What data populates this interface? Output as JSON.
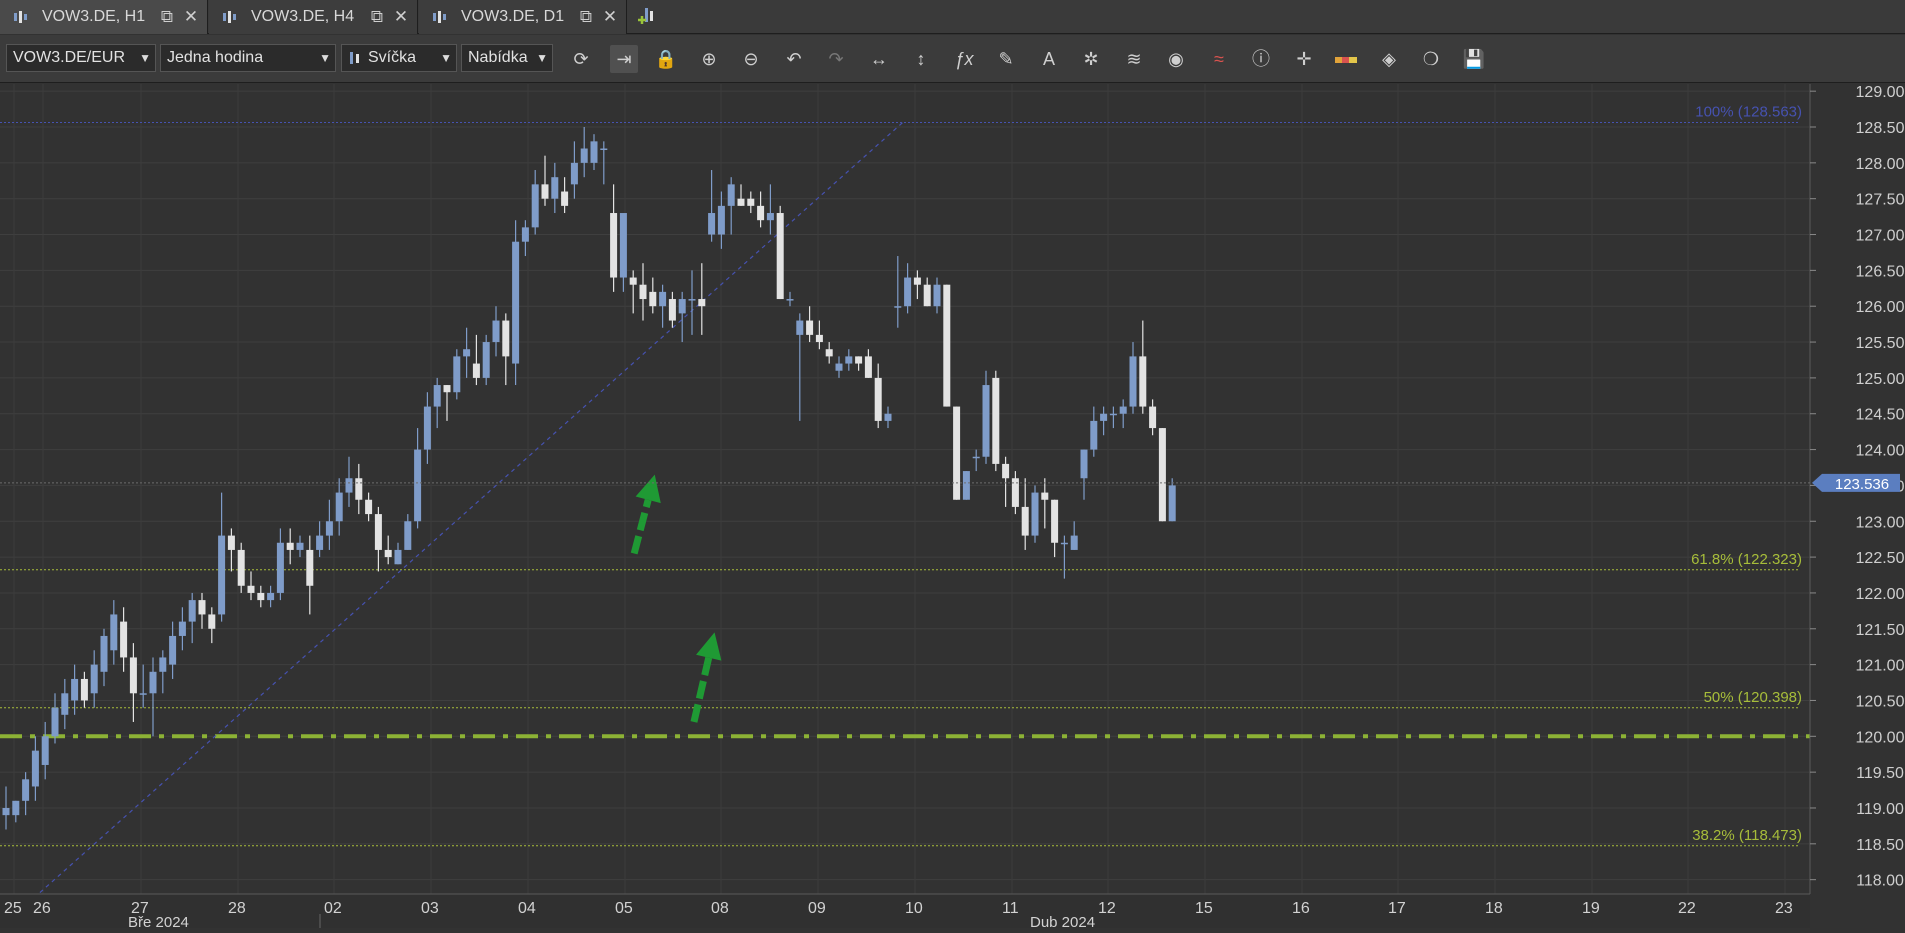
{
  "tabs": [
    {
      "label": "VOW3.DE, H1",
      "active": true
    },
    {
      "label": "VOW3.DE, H4",
      "active": false
    },
    {
      "label": "VOW3.DE, D1",
      "active": false
    }
  ],
  "toolbar": {
    "instrument": "VOW3.DE/EUR",
    "period": "Jedna hodina",
    "chart_type": "Svíčka",
    "price_type": "Nabídka"
  },
  "colors": {
    "background": "#323232",
    "bull": "#7f9cc9",
    "bear": "#e3e3e3",
    "fib_line": "#a7bd3a",
    "level_line": "#8cb235",
    "high_line": "#4652b0",
    "arrow": "#1f9a34",
    "price_badge": "#5b7ec0"
  },
  "chart_data": {
    "type": "candlestick",
    "y_range": [
      117.8,
      129.1
    ],
    "y_ticks": [
      "118.00",
      "118.50",
      "119.00",
      "119.50",
      "120.00",
      "120.50",
      "121.00",
      "121.50",
      "122.00",
      "122.50",
      "123.00",
      "123.50",
      "124.00",
      "124.50",
      "125.00",
      "125.50",
      "126.00",
      "126.50",
      "127.00",
      "127.50",
      "128.00",
      "128.50",
      "129.00"
    ],
    "x_ticks": [
      "25",
      "26",
      "27",
      "28",
      "02",
      "03",
      "04",
      "05",
      "08",
      "09",
      "10",
      "11",
      "12",
      "15",
      "16",
      "17",
      "18",
      "19",
      "22",
      "23"
    ],
    "month_labels": [
      "Bře 2024",
      "Dub 2024"
    ],
    "current_price": "123.536",
    "levels": [
      {
        "label": "100% (128.563)",
        "value": 128.563,
        "color": "#4652b0"
      },
      {
        "label": "61.8% (122.323)",
        "value": 122.323,
        "color": "#a7bd3a"
      },
      {
        "label": "50% (120.398)",
        "value": 120.398,
        "color": "#a7bd3a"
      },
      {
        "label": "38.2% (118.473)",
        "value": 118.473,
        "color": "#a7bd3a"
      }
    ],
    "support_level": 120.0,
    "trend_line": {
      "start": [
        -0.8,
        117.3
      ],
      "end": [
        91.5,
        128.563
      ]
    },
    "arrows": [
      {
        "from": [
          64.1,
          122.55
        ],
        "to": [
          66.2,
          123.65
        ]
      },
      {
        "from": [
          70.2,
          120.2
        ],
        "to": [
          72.3,
          121.45
        ]
      }
    ],
    "candles": [
      {
        "i": 0,
        "o": 118.9,
        "h": 119.3,
        "l": 118.7,
        "c": 119.0
      },
      {
        "i": 1,
        "o": 118.9,
        "h": 119.1,
        "l": 118.8,
        "c": 119.1
      },
      {
        "i": 2,
        "o": 119.1,
        "h": 119.5,
        "l": 118.9,
        "c": 119.4
      },
      {
        "i": 3,
        "o": 119.3,
        "h": 120.0,
        "l": 119.1,
        "c": 119.8
      },
      {
        "i": 4,
        "o": 119.6,
        "h": 120.2,
        "l": 119.4,
        "c": 120.0
      },
      {
        "i": 5,
        "o": 120.0,
        "h": 120.6,
        "l": 119.9,
        "c": 120.4
      },
      {
        "i": 6,
        "o": 120.3,
        "h": 120.8,
        "l": 120.1,
        "c": 120.6
      },
      {
        "i": 7,
        "o": 120.5,
        "h": 121.0,
        "l": 120.3,
        "c": 120.8
      },
      {
        "i": 8,
        "o": 120.8,
        "h": 120.9,
        "l": 120.4,
        "c": 120.5
      },
      {
        "i": 9,
        "o": 120.6,
        "h": 121.2,
        "l": 120.4,
        "c": 121.0
      },
      {
        "i": 10,
        "o": 120.9,
        "h": 121.5,
        "l": 120.7,
        "c": 121.4
      },
      {
        "i": 11,
        "o": 121.2,
        "h": 121.9,
        "l": 121.0,
        "c": 121.7
      },
      {
        "i": 12,
        "o": 121.6,
        "h": 121.8,
        "l": 120.9,
        "c": 121.1
      },
      {
        "i": 13,
        "o": 121.1,
        "h": 121.3,
        "l": 120.2,
        "c": 120.6
      },
      {
        "i": 14,
        "o": 120.6,
        "h": 121.0,
        "l": 120.4,
        "c": 120.6
      },
      {
        "i": 15,
        "o": 120.6,
        "h": 121.1,
        "l": 120.0,
        "c": 120.9
      },
      {
        "i": 16,
        "o": 120.9,
        "h": 121.2,
        "l": 120.6,
        "c": 121.1
      },
      {
        "i": 17,
        "o": 121.0,
        "h": 121.6,
        "l": 120.8,
        "c": 121.4
      },
      {
        "i": 18,
        "o": 121.4,
        "h": 121.8,
        "l": 121.2,
        "c": 121.6
      },
      {
        "i": 19,
        "o": 121.6,
        "h": 122.0,
        "l": 121.3,
        "c": 121.9
      },
      {
        "i": 20,
        "o": 121.9,
        "h": 122.0,
        "l": 121.5,
        "c": 121.7
      },
      {
        "i": 21,
        "o": 121.7,
        "h": 121.8,
        "l": 121.3,
        "c": 121.5
      },
      {
        "i": 22,
        "o": 121.7,
        "h": 123.4,
        "l": 121.6,
        "c": 122.8
      },
      {
        "i": 23,
        "o": 122.8,
        "h": 122.9,
        "l": 122.3,
        "c": 122.6
      },
      {
        "i": 24,
        "o": 122.6,
        "h": 122.7,
        "l": 122.0,
        "c": 122.1
      },
      {
        "i": 25,
        "o": 122.1,
        "h": 122.3,
        "l": 121.9,
        "c": 122.0
      },
      {
        "i": 26,
        "o": 122.0,
        "h": 122.1,
        "l": 121.8,
        "c": 121.9
      },
      {
        "i": 27,
        "o": 121.9,
        "h": 122.1,
        "l": 121.8,
        "c": 122.0
      },
      {
        "i": 28,
        "o": 122.0,
        "h": 122.9,
        "l": 121.9,
        "c": 122.7
      },
      {
        "i": 29,
        "o": 122.7,
        "h": 122.9,
        "l": 122.4,
        "c": 122.6
      },
      {
        "i": 30,
        "o": 122.6,
        "h": 122.8,
        "l": 122.5,
        "c": 122.7
      },
      {
        "i": 31,
        "o": 122.6,
        "h": 122.8,
        "l": 121.7,
        "c": 122.1
      },
      {
        "i": 32,
        "o": 122.6,
        "h": 123.0,
        "l": 122.5,
        "c": 122.8
      },
      {
        "i": 33,
        "o": 122.8,
        "h": 123.3,
        "l": 122.6,
        "c": 123.0
      },
      {
        "i": 34,
        "o": 123.0,
        "h": 123.6,
        "l": 122.8,
        "c": 123.4
      },
      {
        "i": 35,
        "o": 123.4,
        "h": 123.9,
        "l": 123.2,
        "c": 123.6
      },
      {
        "i": 36,
        "o": 123.6,
        "h": 123.8,
        "l": 123.1,
        "c": 123.3
      },
      {
        "i": 37,
        "o": 123.3,
        "h": 123.4,
        "l": 123.0,
        "c": 123.1
      },
      {
        "i": 38,
        "o": 123.1,
        "h": 123.2,
        "l": 122.3,
        "c": 122.6
      },
      {
        "i": 39,
        "o": 122.6,
        "h": 122.8,
        "l": 122.4,
        "c": 122.5
      },
      {
        "i": 40,
        "o": 122.4,
        "h": 122.7,
        "l": 122.4,
        "c": 122.6
      },
      {
        "i": 41,
        "o": 122.6,
        "h": 123.1,
        "l": 122.6,
        "c": 123.0
      },
      {
        "i": 42,
        "o": 123.0,
        "h": 124.3,
        "l": 122.9,
        "c": 124.0
      },
      {
        "i": 43,
        "o": 124.0,
        "h": 124.8,
        "l": 123.8,
        "c": 124.6
      },
      {
        "i": 44,
        "o": 124.6,
        "h": 125.0,
        "l": 124.3,
        "c": 124.9
      },
      {
        "i": 45,
        "o": 124.9,
        "h": 124.9,
        "l": 124.4,
        "c": 124.8
      },
      {
        "i": 46,
        "o": 124.8,
        "h": 125.4,
        "l": 124.7,
        "c": 125.3
      },
      {
        "i": 47,
        "o": 125.3,
        "h": 125.7,
        "l": 125.0,
        "c": 125.4
      },
      {
        "i": 48,
        "o": 125.2,
        "h": 125.6,
        "l": 124.9,
        "c": 125.0
      },
      {
        "i": 49,
        "o": 125.0,
        "h": 125.6,
        "l": 124.9,
        "c": 125.5
      },
      {
        "i": 50,
        "o": 125.5,
        "h": 126.0,
        "l": 125.3,
        "c": 125.8
      },
      {
        "i": 51,
        "o": 125.8,
        "h": 125.9,
        "l": 124.9,
        "c": 125.3
      },
      {
        "i": 52,
        "o": 125.2,
        "h": 127.2,
        "l": 124.9,
        "c": 126.9
      },
      {
        "i": 53,
        "o": 126.9,
        "h": 127.2,
        "l": 126.7,
        "c": 127.1
      },
      {
        "i": 54,
        "o": 127.1,
        "h": 127.9,
        "l": 127.0,
        "c": 127.7
      },
      {
        "i": 55,
        "o": 127.7,
        "h": 128.1,
        "l": 127.4,
        "c": 127.5
      },
      {
        "i": 56,
        "o": 127.5,
        "h": 128.0,
        "l": 127.3,
        "c": 127.8
      },
      {
        "i": 57,
        "o": 127.6,
        "h": 127.8,
        "l": 127.3,
        "c": 127.4
      },
      {
        "i": 58,
        "o": 127.7,
        "h": 128.3,
        "l": 127.5,
        "c": 128.0
      },
      {
        "i": 59,
        "o": 128.0,
        "h": 128.5,
        "l": 127.8,
        "c": 128.2
      },
      {
        "i": 60,
        "o": 128.0,
        "h": 128.4,
        "l": 127.9,
        "c": 128.3
      },
      {
        "i": 61,
        "o": 128.2,
        "h": 128.3,
        "l": 127.7,
        "c": 128.2
      },
      {
        "i": 62,
        "o": 127.3,
        "h": 127.7,
        "l": 126.2,
        "c": 126.4
      },
      {
        "i": 63,
        "o": 126.4,
        "h": 126.9,
        "l": 126.2,
        "c": 127.3
      },
      {
        "i": 64,
        "o": 126.4,
        "h": 126.5,
        "l": 125.9,
        "c": 126.3
      },
      {
        "i": 65,
        "o": 126.3,
        "h": 126.6,
        "l": 125.8,
        "c": 126.1
      },
      {
        "i": 66,
        "o": 126.2,
        "h": 126.4,
        "l": 125.9,
        "c": 126.0
      },
      {
        "i": 67,
        "o": 126.0,
        "h": 126.3,
        "l": 125.7,
        "c": 126.2
      },
      {
        "i": 68,
        "o": 126.1,
        "h": 126.2,
        "l": 125.7,
        "c": 125.8
      },
      {
        "i": 69,
        "o": 125.9,
        "h": 126.2,
        "l": 125.5,
        "c": 126.1
      },
      {
        "i": 70,
        "o": 126.1,
        "h": 126.5,
        "l": 125.6,
        "c": 126.1
      },
      {
        "i": 71,
        "o": 126.1,
        "h": 126.6,
        "l": 125.6,
        "c": 126.0
      },
      {
        "i": 72,
        "o": 127.0,
        "h": 127.9,
        "l": 126.9,
        "c": 127.3
      },
      {
        "i": 73,
        "o": 127.0,
        "h": 127.6,
        "l": 126.8,
        "c": 127.4
      },
      {
        "i": 74,
        "o": 127.4,
        "h": 127.8,
        "l": 127.0,
        "c": 127.7
      },
      {
        "i": 75,
        "o": 127.5,
        "h": 127.7,
        "l": 127.4,
        "c": 127.4
      },
      {
        "i": 76,
        "o": 127.5,
        "h": 127.6,
        "l": 127.3,
        "c": 127.4
      },
      {
        "i": 77,
        "o": 127.4,
        "h": 127.6,
        "l": 127.1,
        "c": 127.2
      },
      {
        "i": 78,
        "o": 127.2,
        "h": 127.7,
        "l": 127.0,
        "c": 127.3
      },
      {
        "i": 79,
        "o": 127.3,
        "h": 127.4,
        "l": 126.1,
        "c": 126.1
      },
      {
        "i": 80,
        "o": 126.1,
        "h": 126.2,
        "l": 126.0,
        "c": 126.1
      },
      {
        "i": 81,
        "o": 125.6,
        "h": 125.9,
        "l": 124.4,
        "c": 125.8
      },
      {
        "i": 82,
        "o": 125.8,
        "h": 126.0,
        "l": 125.5,
        "c": 125.6
      },
      {
        "i": 83,
        "o": 125.6,
        "h": 125.8,
        "l": 125.4,
        "c": 125.5
      },
      {
        "i": 84,
        "o": 125.4,
        "h": 125.5,
        "l": 125.2,
        "c": 125.3
      },
      {
        "i": 85,
        "o": 125.1,
        "h": 125.3,
        "l": 125.0,
        "c": 125.2
      },
      {
        "i": 86,
        "o": 125.2,
        "h": 125.4,
        "l": 125.1,
        "c": 125.3
      },
      {
        "i": 87,
        "o": 125.3,
        "h": 125.3,
        "l": 125.1,
        "c": 125.2
      },
      {
        "i": 88,
        "o": 125.3,
        "h": 125.4,
        "l": 125.0,
        "c": 125.0
      },
      {
        "i": 89,
        "o": 125.0,
        "h": 125.2,
        "l": 124.3,
        "c": 124.4
      },
      {
        "i": 90,
        "o": 124.4,
        "h": 124.6,
        "l": 124.3,
        "c": 124.5
      },
      {
        "i": 91,
        "o": 126.0,
        "h": 126.7,
        "l": 125.7,
        "c": 126.0
      },
      {
        "i": 92,
        "o": 126.0,
        "h": 126.6,
        "l": 125.9,
        "c": 126.4
      },
      {
        "i": 93,
        "o": 126.4,
        "h": 126.5,
        "l": 126.1,
        "c": 126.3
      },
      {
        "i": 94,
        "o": 126.3,
        "h": 126.4,
        "l": 126.0,
        "c": 126.0
      },
      {
        "i": 95,
        "o": 126.0,
        "h": 126.4,
        "l": 125.9,
        "c": 126.3
      },
      {
        "i": 96,
        "o": 126.3,
        "h": 126.3,
        "l": 124.6,
        "c": 124.6
      },
      {
        "i": 97,
        "o": 124.6,
        "h": 124.6,
        "l": 123.3,
        "c": 123.3
      },
      {
        "i": 98,
        "o": 123.3,
        "h": 123.7,
        "l": 123.3,
        "c": 123.7
      },
      {
        "i": 99,
        "o": 123.9,
        "h": 124.0,
        "l": 123.7,
        "c": 123.9
      },
      {
        "i": 100,
        "o": 123.9,
        "h": 125.1,
        "l": 123.8,
        "c": 124.9
      },
      {
        "i": 101,
        "o": 125.0,
        "h": 125.1,
        "l": 123.7,
        "c": 123.8
      },
      {
        "i": 102,
        "o": 123.8,
        "h": 123.9,
        "l": 123.2,
        "c": 123.6
      },
      {
        "i": 103,
        "o": 123.6,
        "h": 123.7,
        "l": 123.1,
        "c": 123.2
      },
      {
        "i": 104,
        "o": 123.2,
        "h": 123.6,
        "l": 122.6,
        "c": 122.8
      },
      {
        "i": 105,
        "o": 122.8,
        "h": 123.5,
        "l": 122.7,
        "c": 123.4
      },
      {
        "i": 106,
        "o": 123.4,
        "h": 123.6,
        "l": 122.9,
        "c": 123.3
      },
      {
        "i": 107,
        "o": 123.3,
        "h": 123.3,
        "l": 122.5,
        "c": 122.7
      },
      {
        "i": 108,
        "o": 122.7,
        "h": 122.8,
        "l": 122.2,
        "c": 122.7
      },
      {
        "i": 109,
        "o": 122.6,
        "h": 123.0,
        "l": 122.6,
        "c": 122.8
      },
      {
        "i": 110,
        "o": 123.6,
        "h": 124.0,
        "l": 123.3,
        "c": 124.0
      },
      {
        "i": 111,
        "o": 124.0,
        "h": 124.6,
        "l": 123.9,
        "c": 124.4
      },
      {
        "i": 112,
        "o": 124.4,
        "h": 124.6,
        "l": 124.2,
        "c": 124.5
      },
      {
        "i": 113,
        "o": 124.5,
        "h": 124.6,
        "l": 124.3,
        "c": 124.5
      },
      {
        "i": 114,
        "o": 124.5,
        "h": 124.7,
        "l": 124.3,
        "c": 124.6
      },
      {
        "i": 115,
        "o": 124.6,
        "h": 125.5,
        "l": 124.5,
        "c": 125.3
      },
      {
        "i": 116,
        "o": 125.3,
        "h": 125.8,
        "l": 124.5,
        "c": 124.6
      },
      {
        "i": 117,
        "o": 124.6,
        "h": 124.7,
        "l": 124.2,
        "c": 124.3
      },
      {
        "i": 118,
        "o": 124.3,
        "h": 124.3,
        "l": 123.0,
        "c": 123.0
      },
      {
        "i": 119,
        "o": 123.0,
        "h": 123.6,
        "l": 123.0,
        "c": 123.5
      }
    ]
  }
}
